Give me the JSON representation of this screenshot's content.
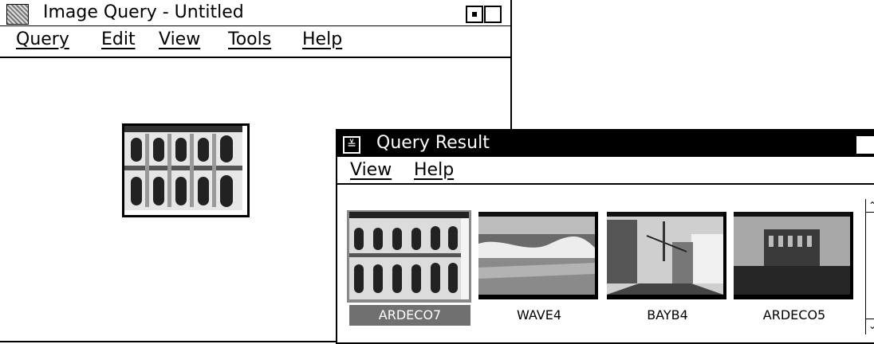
{
  "main_window": {
    "title": "Image Query - Untitled",
    "menu": [
      "Query",
      "Edit",
      "View",
      "Tools",
      "Help"
    ],
    "icons": {
      "system": "app-icon",
      "minimize": "minimize-icon",
      "maximize": "maximize-icon"
    }
  },
  "result_window": {
    "title": "Query Result",
    "menu": [
      "View",
      "Help"
    ],
    "thumbnails": [
      {
        "label": "ARDECO7",
        "selected": true
      },
      {
        "label": "WAVE4",
        "selected": false
      },
      {
        "label": "BAYB4",
        "selected": false
      },
      {
        "label": "ARDECO5",
        "selected": false
      }
    ],
    "scroll_arrows": {
      "up": "⌃",
      "down": "⌄"
    }
  }
}
